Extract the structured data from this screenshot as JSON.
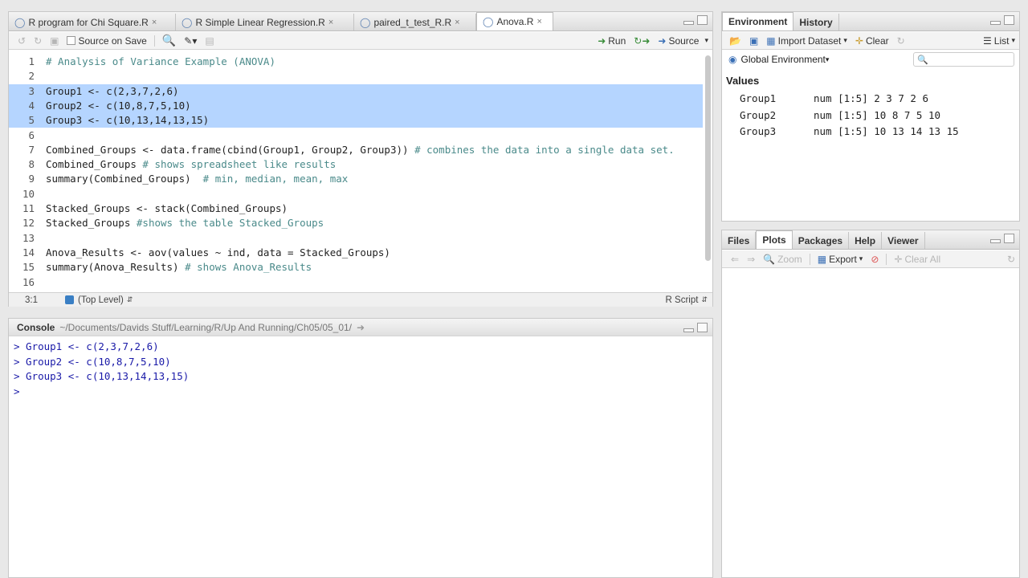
{
  "editor": {
    "tabs": [
      {
        "label": "R program for Chi Square.R",
        "active": false
      },
      {
        "label": "R Simple Linear Regression.R",
        "active": false
      },
      {
        "label": "paired_t_test_R.R",
        "active": false
      },
      {
        "label": "Anova.R",
        "active": true
      }
    ],
    "tab_close": "×",
    "toolbar": {
      "source_on_save": "Source on Save",
      "run": "Run",
      "source": "Source"
    },
    "lines": [
      {
        "n": "1",
        "text": "# Analysis of Variance Example (ANOVA)",
        "comment": "",
        "selected": false
      },
      {
        "n": "2",
        "text": "",
        "comment": "",
        "selected": false
      },
      {
        "n": "3",
        "text": "Group1 <- c(2,3,7,2,6)",
        "comment": "",
        "selected": true
      },
      {
        "n": "4",
        "text": "Group2 <- c(10,8,7,5,10)",
        "comment": "",
        "selected": true
      },
      {
        "n": "5",
        "text": "Group3 <- c(10,13,14,13,15)",
        "comment": "",
        "selected": true
      },
      {
        "n": "6",
        "text": "",
        "comment": "",
        "selected": false
      },
      {
        "n": "7",
        "text": "Combined_Groups <- data.frame(cbind(Group1, Group2, Group3)) ",
        "comment": "# combines the data into a single data set.",
        "selected": false
      },
      {
        "n": "8",
        "text": "Combined_Groups ",
        "comment": "# shows spreadsheet like results",
        "selected": false
      },
      {
        "n": "9",
        "text": "summary(Combined_Groups)  ",
        "comment": "# min, median, mean, max",
        "selected": false
      },
      {
        "n": "10",
        "text": "",
        "comment": "",
        "selected": false
      },
      {
        "n": "11",
        "text": "Stacked_Groups <- stack(Combined_Groups)",
        "comment": "",
        "selected": false
      },
      {
        "n": "12",
        "text": "Stacked_Groups ",
        "comment": "#shows the table Stacked_Groups",
        "selected": false
      },
      {
        "n": "13",
        "text": "",
        "comment": "",
        "selected": false
      },
      {
        "n": "14",
        "text": "Anova_Results <- aov(values ~ ind, data = Stacked_Groups)",
        "comment": "",
        "selected": false
      },
      {
        "n": "15",
        "text": "summary(Anova_Results) ",
        "comment": "# shows Anova_Results",
        "selected": false
      },
      {
        "n": "16",
        "text": "",
        "comment": "",
        "selected": false
      }
    ],
    "status": {
      "position": "3:1",
      "scope": "(Top Level)",
      "file_type": "R Script"
    }
  },
  "console": {
    "title": "Console",
    "path": "~/Documents/Davids Stuff/Learning/R/Up And Running/Ch05/05_01/",
    "lines": [
      "> Group1 <- c(2,3,7,2,6)",
      "> Group2 <- c(10,8,7,5,10)",
      "> Group3 <- c(10,13,14,13,15)",
      "> "
    ]
  },
  "environment": {
    "tabs": [
      "Environment",
      "History"
    ],
    "toolbar": {
      "import_dataset": "Import Dataset",
      "clear": "Clear",
      "list": "List"
    },
    "scope": "Global Environment",
    "section": "Values",
    "rows": [
      {
        "name": "Group1",
        "value": "num [1:5] 2 3 7 2 6"
      },
      {
        "name": "Group2",
        "value": "num [1:5] 10 8 7 5 10"
      },
      {
        "name": "Group3",
        "value": "num [1:5] 10 13 14 13 15"
      }
    ]
  },
  "files": {
    "tabs": [
      "Files",
      "Plots",
      "Packages",
      "Help",
      "Viewer"
    ],
    "active_tab": "Plots",
    "toolbar": {
      "zoom": "Zoom",
      "export": "Export",
      "clear_all": "Clear All"
    }
  },
  "colors": {
    "selection": "#b5d5ff",
    "comment": "#4a8a8a",
    "console_text": "#1a1aa8"
  }
}
